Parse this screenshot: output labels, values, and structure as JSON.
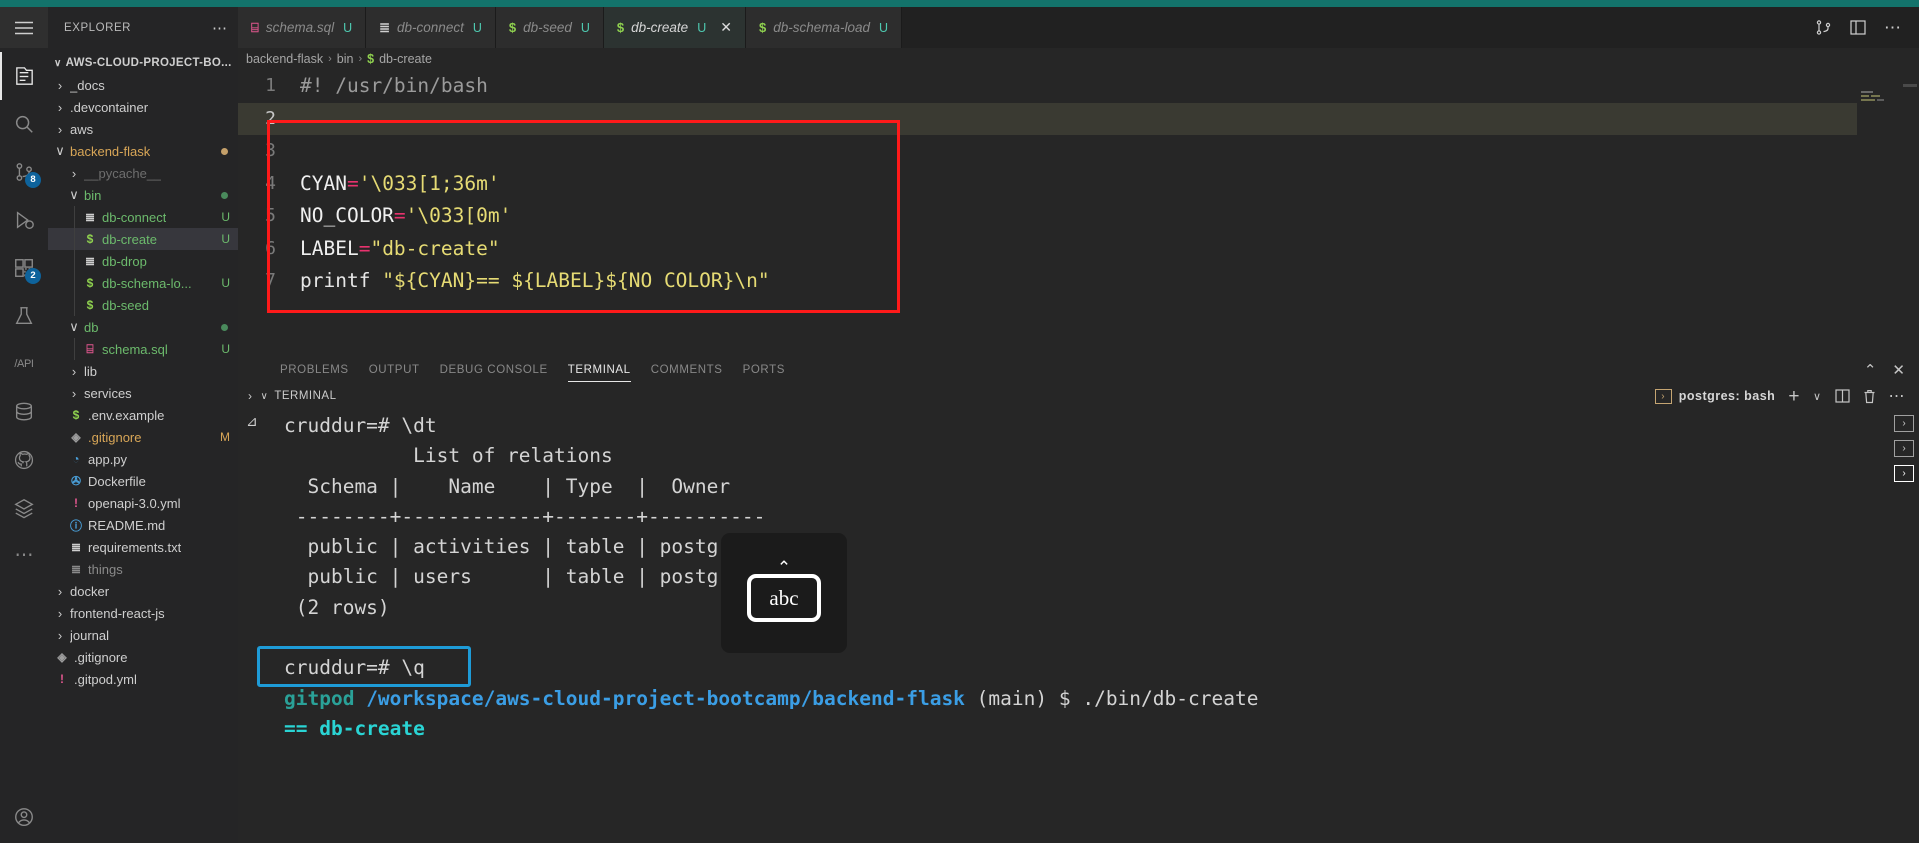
{
  "window": {
    "hamburger_icon": "menu-icon",
    "explorer_title": "EXPLORER",
    "explorer_more": "⋯"
  },
  "tabs": [
    {
      "icon": "database-icon",
      "name": "schema.sql",
      "modified": "U",
      "active": false,
      "closable": false
    },
    {
      "icon": "text-file-icon",
      "name": "db-connect",
      "modified": "U",
      "active": false,
      "closable": false
    },
    {
      "icon": "shell-icon",
      "name": "db-seed",
      "modified": "U",
      "active": false,
      "closable": false
    },
    {
      "icon": "shell-icon",
      "name": "db-create",
      "modified": "U",
      "active": true,
      "closable": true
    },
    {
      "icon": "shell-icon",
      "name": "db-schema-load",
      "modified": "U",
      "active": false,
      "closable": false
    }
  ],
  "title_actions": [
    {
      "name": "split-editor-right-icon",
      "glyph": "⎇"
    },
    {
      "name": "toggle-panel-icon",
      "glyph": "◫"
    },
    {
      "name": "more-actions-icon",
      "glyph": "⋯"
    }
  ],
  "activitybar": [
    {
      "name": "explorer-icon",
      "glyph": "files",
      "active": true,
      "badge": null
    },
    {
      "name": "search-icon",
      "glyph": "search",
      "active": false,
      "badge": null
    },
    {
      "name": "source-control-icon",
      "glyph": "branch",
      "active": false,
      "badge": "8"
    },
    {
      "name": "run-debug-icon",
      "glyph": "debug",
      "active": false,
      "badge": null
    },
    {
      "name": "extensions-icon",
      "glyph": "ext",
      "active": false,
      "badge": "2"
    },
    {
      "name": "testing-icon",
      "glyph": "beaker",
      "active": false,
      "badge": null
    },
    {
      "name": "api-icon",
      "glyph": "/API",
      "active": false,
      "badge": null
    },
    {
      "name": "database-icon",
      "glyph": "db",
      "active": false,
      "badge": null
    },
    {
      "name": "github-icon",
      "glyph": "gh",
      "active": false,
      "badge": null
    },
    {
      "name": "layers-icon",
      "glyph": "layers",
      "active": false,
      "badge": null
    },
    {
      "name": "more-views-icon",
      "glyph": "⋯",
      "active": false,
      "badge": null
    }
  ],
  "activitybar_bottom": [
    {
      "name": "accounts-icon",
      "glyph": "account"
    },
    {
      "name": "settings-gear-icon",
      "glyph": "gear"
    }
  ],
  "sidebar": {
    "root_label": "AWS-CLOUD-PROJECT-BO...",
    "items": [
      {
        "label": "_docs",
        "indent": 1,
        "type": "folder",
        "chev": "›",
        "icon": "",
        "icon_color": "",
        "text_color": "#cfcfcf",
        "modified": "",
        "dot": ""
      },
      {
        "label": ".devcontainer",
        "indent": 1,
        "type": "folder",
        "chev": "›",
        "icon": "",
        "icon_color": "",
        "text_color": "#cfcfcf",
        "modified": "",
        "dot": ""
      },
      {
        "label": "aws",
        "indent": 1,
        "type": "folder",
        "chev": "›",
        "icon": "",
        "icon_color": "",
        "text_color": "#cfcfcf",
        "modified": "",
        "dot": ""
      },
      {
        "label": "backend-flask",
        "indent": 1,
        "type": "folder",
        "chev": "∨",
        "icon": "",
        "icon_color": "",
        "text_color": "#d8a657",
        "modified": "",
        "dot": "orange"
      },
      {
        "label": "__pycache__",
        "indent": 2,
        "type": "folder",
        "chev": "›",
        "icon": "",
        "icon_color": "",
        "text_color": "#6e6e6e",
        "modified": "",
        "dot": ""
      },
      {
        "label": "bin",
        "indent": 2,
        "type": "folder",
        "chev": "∨",
        "icon": "",
        "icon_color": "",
        "text_color": "#6cba6c",
        "modified": "",
        "dot": "green"
      },
      {
        "label": "db-connect",
        "indent": 3,
        "type": "file",
        "chev": "",
        "icon": "≣",
        "icon_color": "#cfcfcf",
        "text_color": "#6cba6c",
        "modified": "U",
        "dot": ""
      },
      {
        "label": "db-create",
        "indent": 3,
        "type": "file",
        "chev": "",
        "icon": "$",
        "icon_color": "#8fd14f",
        "text_color": "#6cba6c",
        "modified": "U",
        "dot": "",
        "selected": true
      },
      {
        "label": "db-drop",
        "indent": 3,
        "type": "file",
        "chev": "",
        "icon": "≣",
        "icon_color": "#cfcfcf",
        "text_color": "#6cba6c",
        "modified": "",
        "dot": ""
      },
      {
        "label": "db-schema-lo...",
        "indent": 3,
        "type": "file",
        "chev": "",
        "icon": "$",
        "icon_color": "#8fd14f",
        "text_color": "#6cba6c",
        "modified": "U",
        "dot": ""
      },
      {
        "label": "db-seed",
        "indent": 3,
        "type": "file",
        "chev": "",
        "icon": "$",
        "icon_color": "#8fd14f",
        "text_color": "#6cba6c",
        "modified": "",
        "dot": ""
      },
      {
        "label": "db",
        "indent": 2,
        "type": "folder",
        "chev": "∨",
        "icon": "",
        "icon_color": "",
        "text_color": "#6cba6c",
        "modified": "",
        "dot": "green"
      },
      {
        "label": "schema.sql",
        "indent": 3,
        "type": "file",
        "chev": "",
        "icon": "⌸",
        "icon_color": "#e0568e",
        "text_color": "#6cba6c",
        "modified": "U",
        "dot": ""
      },
      {
        "label": "lib",
        "indent": 2,
        "type": "folder",
        "chev": "›",
        "icon": "",
        "icon_color": "",
        "text_color": "#cfcfcf",
        "modified": "",
        "dot": ""
      },
      {
        "label": "services",
        "indent": 2,
        "type": "folder",
        "chev": "›",
        "icon": "",
        "icon_color": "",
        "text_color": "#cfcfcf",
        "modified": "",
        "dot": ""
      },
      {
        "label": ".env.example",
        "indent": 2,
        "type": "file",
        "chev": "",
        "icon": "$",
        "icon_color": "#8fd14f",
        "text_color": "#cfcfcf",
        "modified": "",
        "dot": ""
      },
      {
        "label": ".gitignore",
        "indent": 2,
        "type": "file",
        "chev": "",
        "icon": "◈",
        "icon_color": "#9e9e9e",
        "text_color": "#d8a657",
        "modified": "M",
        "dot": ""
      },
      {
        "label": "app.py",
        "indent": 2,
        "type": "file",
        "chev": "",
        "icon": "◔",
        "icon_color": "#4a9fd8",
        "text_color": "#cfcfcf",
        "modified": "",
        "dot": ""
      },
      {
        "label": "Dockerfile",
        "indent": 2,
        "type": "file",
        "chev": "",
        "icon": "✇",
        "icon_color": "#4a9fd8",
        "text_color": "#cfcfcf",
        "modified": "",
        "dot": ""
      },
      {
        "label": "openapi-3.0.yml",
        "indent": 2,
        "type": "file",
        "chev": "",
        "icon": "!",
        "icon_color": "#e0568e",
        "text_color": "#cfcfcf",
        "modified": "",
        "dot": ""
      },
      {
        "label": "README.md",
        "indent": 2,
        "type": "file",
        "chev": "",
        "icon": "ⓘ",
        "icon_color": "#4a9fd8",
        "text_color": "#cfcfcf",
        "modified": "",
        "dot": ""
      },
      {
        "label": "requirements.txt",
        "indent": 2,
        "type": "file",
        "chev": "",
        "icon": "≣",
        "icon_color": "#cfcfcf",
        "text_color": "#cfcfcf",
        "modified": "",
        "dot": ""
      },
      {
        "label": "things",
        "indent": 2,
        "type": "file",
        "chev": "",
        "icon": "≣",
        "icon_color": "#8a8a8a",
        "text_color": "#8a8a8a",
        "modified": "",
        "dot": ""
      },
      {
        "label": "docker",
        "indent": 1,
        "type": "folder",
        "chev": "›",
        "icon": "",
        "icon_color": "",
        "text_color": "#cfcfcf",
        "modified": "",
        "dot": ""
      },
      {
        "label": "frontend-react-js",
        "indent": 1,
        "type": "folder",
        "chev": "›",
        "icon": "",
        "icon_color": "",
        "text_color": "#cfcfcf",
        "modified": "",
        "dot": ""
      },
      {
        "label": "journal",
        "indent": 1,
        "type": "folder",
        "chev": "›",
        "icon": "",
        "icon_color": "",
        "text_color": "#cfcfcf",
        "modified": "",
        "dot": ""
      },
      {
        "label": ".gitignore",
        "indent": 1,
        "type": "file",
        "chev": "",
        "icon": "◈",
        "icon_color": "#9e9e9e",
        "text_color": "#cfcfcf",
        "modified": "",
        "dot": ""
      },
      {
        "label": ".gitpod.yml",
        "indent": 1,
        "type": "file",
        "chev": "",
        "icon": "!",
        "icon_color": "#e0568e",
        "text_color": "#cfcfcf",
        "modified": "",
        "dot": ""
      }
    ]
  },
  "breadcrumb": {
    "parts": [
      "backend-flask",
      "bin"
    ],
    "file_icon": "$",
    "file": "db-create",
    "separator": "›"
  },
  "editor": {
    "lines": [
      {
        "no": "1",
        "current": false,
        "tokens": [
          {
            "t": "#! /usr/bin/bash",
            "c": "comment"
          }
        ]
      },
      {
        "no": "2",
        "current": true,
        "tokens": []
      },
      {
        "no": "3",
        "current": false,
        "tokens": []
      },
      {
        "no": "4",
        "current": false,
        "tokens": [
          {
            "t": "CYAN",
            "c": "var"
          },
          {
            "t": "=",
            "c": "eq"
          },
          {
            "t": "'\\033[1;36m'",
            "c": "str"
          }
        ]
      },
      {
        "no": "5",
        "current": false,
        "tokens": [
          {
            "t": "NO_COLOR",
            "c": "var"
          },
          {
            "t": "=",
            "c": "eq"
          },
          {
            "t": "'\\033[0m'",
            "c": "str"
          }
        ]
      },
      {
        "no": "6",
        "current": false,
        "tokens": [
          {
            "t": "LABEL",
            "c": "var"
          },
          {
            "t": "=",
            "c": "eq"
          },
          {
            "t": "\"db-create\"",
            "c": "str"
          }
        ]
      },
      {
        "no": "7",
        "current": false,
        "tokens": [
          {
            "t": "printf ",
            "c": "cmd"
          },
          {
            "t": "\"${CYAN}== ${LABEL}${NO COLOR}\\n\"",
            "c": "str"
          }
        ]
      }
    ]
  },
  "panel": {
    "tabs": [
      {
        "label": "PROBLEMS",
        "active": false
      },
      {
        "label": "OUTPUT",
        "active": false
      },
      {
        "label": "DEBUG CONSOLE",
        "active": false
      },
      {
        "label": "TERMINAL",
        "active": true
      },
      {
        "label": "COMMENTS",
        "active": false
      },
      {
        "label": "PORTS",
        "active": false
      }
    ],
    "actions": [
      {
        "name": "maximize-panel-icon",
        "glyph": "⌃"
      },
      {
        "name": "close-panel-icon",
        "glyph": "✕"
      }
    ],
    "terminal_label": "TERMINAL",
    "terminal_chevron": "∨",
    "terminal_session": "postgres: bash",
    "terminal_session_icon": "›",
    "head_actions": [
      {
        "name": "new-terminal-icon",
        "glyph": "+"
      },
      {
        "name": "terminal-dropdown-icon",
        "glyph": "∨"
      },
      {
        "name": "split-terminal-icon",
        "glyph": "◫"
      },
      {
        "name": "kill-terminal-icon",
        "glyph": "Ὕ1"
      },
      {
        "name": "terminal-more-icon",
        "glyph": "⋯"
      }
    ]
  },
  "terminal": {
    "lines": [
      {
        "segments": [
          {
            "t": "cruddur=# \\dt",
            "c": "plain"
          }
        ]
      },
      {
        "segments": [
          {
            "t": "           List of relations",
            "c": "plain"
          }
        ]
      },
      {
        "segments": [
          {
            "t": "  Schema |    Name    | Type  |  Owner",
            "c": "plain"
          }
        ]
      },
      {
        "segments": [
          {
            "t": " --------+------------+-------+----------",
            "c": "plain"
          }
        ]
      },
      {
        "segments": [
          {
            "t": "  public | activities | table | postgres",
            "c": "plain"
          }
        ]
      },
      {
        "segments": [
          {
            "t": "  public | users      | table | postgres",
            "c": "plain"
          }
        ]
      },
      {
        "segments": [
          {
            "t": " (2 rows)",
            "c": "plain"
          }
        ]
      },
      {
        "segments": [
          {
            "t": "",
            "c": "plain"
          }
        ]
      },
      {
        "segments": [
          {
            "t": "cruddur=# \\q",
            "c": "plain"
          }
        ]
      },
      {
        "segments": [
          {
            "t": "gitpod ",
            "c": "green"
          },
          {
            "t": "/workspace/aws-cloud-project-bootcamp/backend-flask",
            "c": "path"
          },
          {
            "t": " (main) $ ./bin/db-create",
            "c": "plain"
          }
        ]
      },
      {
        "segments": [
          {
            "t": "== db-create",
            "c": "cyan"
          }
        ]
      }
    ],
    "side_buttons": [
      {
        "name": "terminal-scroll-up-icon",
        "glyph": "›",
        "highlight": false
      },
      {
        "name": "terminal-scroll-mid-icon",
        "glyph": "›",
        "highlight": false
      },
      {
        "name": "terminal-scroll-down-icon",
        "glyph": "›",
        "highlight": true
      }
    ]
  },
  "overlays": {
    "keyboard_hint_caret": "⌃",
    "keyboard_hint_label": "abc"
  },
  "colors": {
    "accent_red": "#ff1a1a",
    "accent_blue": "#1e9bd7",
    "teal_strip": "#13736b",
    "terminal_cyan": "#2ad4d4",
    "prompt_green": "#2aa198",
    "prompt_path_blue": "#3b9ee5"
  }
}
